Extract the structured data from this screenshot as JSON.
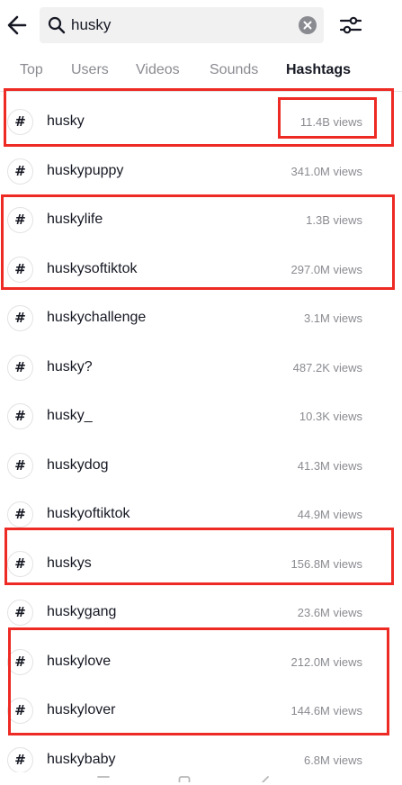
{
  "search": {
    "query": "husky"
  },
  "tabs": [
    {
      "label": "Top"
    },
    {
      "label": "Users"
    },
    {
      "label": "Videos"
    },
    {
      "label": "Sounds"
    },
    {
      "label": "Hashtags"
    }
  ],
  "active_tab": "Hashtags",
  "hashtag_symbol": "#",
  "results": [
    {
      "name": "husky",
      "views": "11.4B views"
    },
    {
      "name": "huskypuppy",
      "views": "341.0M views"
    },
    {
      "name": "huskylife",
      "views": "1.3B views"
    },
    {
      "name": "huskysoftiktok",
      "views": "297.0M views"
    },
    {
      "name": "huskychallenge",
      "views": "3.1M views"
    },
    {
      "name": "husky?",
      "views": "487.2K views"
    },
    {
      "name": "husky_",
      "views": "10.3K views"
    },
    {
      "name": "huskydog",
      "views": "41.3M views"
    },
    {
      "name": "huskyoftiktok",
      "views": "44.9M views"
    },
    {
      "name": "huskys",
      "views": "156.8M views"
    },
    {
      "name": "huskygang",
      "views": "23.6M views"
    },
    {
      "name": "huskylove",
      "views": "212.0M views"
    },
    {
      "name": "huskylover",
      "views": "144.6M views"
    },
    {
      "name": "huskybaby",
      "views": "6.8M views"
    }
  ],
  "colors": {
    "highlight": "#ee2a24",
    "text": "#161823",
    "muted": "#8a8b91"
  }
}
